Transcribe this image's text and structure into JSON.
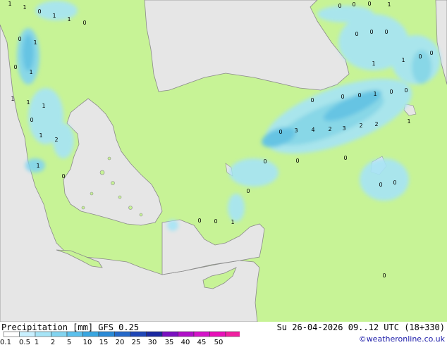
{
  "footer": {
    "title": "Precipitation [mm] GFS 0.25",
    "runinfo": "Su 26-04-2026 09..12 UTC (18+330)",
    "credit": "©weatheronline.co.uk"
  },
  "legend": {
    "ticks": [
      "0.1",
      "0.5",
      "1",
      "2",
      "5",
      "10",
      "15",
      "20",
      "25",
      "30",
      "35",
      "40",
      "45",
      "50"
    ],
    "colors": [
      "#ffffff",
      "#c8f0ff",
      "#a6e4f6",
      "#82d4f0",
      "#5bc0ec",
      "#39a6e0",
      "#2a8ad6",
      "#2468c8",
      "#1f46b6",
      "#1a28a0",
      "#7a10c0",
      "#b010c8",
      "#d414c8",
      "#e810b8",
      "#f020a0"
    ]
  },
  "map": {
    "colors": {
      "land": "#c7f396",
      "sea": "#e6e6e6",
      "coast": "#8a8a8a"
    },
    "labels": [
      {
        "text": "1"
      },
      {
        "text": "1"
      },
      {
        "text": "0"
      },
      {
        "text": "1"
      },
      {
        "text": "1"
      },
      {
        "text": "0"
      },
      {
        "text": "0"
      },
      {
        "text": "0"
      },
      {
        "text": "0"
      },
      {
        "text": "1"
      },
      {
        "text": "0"
      },
      {
        "text": "1"
      },
      {
        "text": "0"
      },
      {
        "text": "1"
      },
      {
        "text": "0"
      },
      {
        "text": "0"
      },
      {
        "text": "0"
      },
      {
        "text": "1"
      },
      {
        "text": "1"
      },
      {
        "text": "0"
      },
      {
        "text": "0"
      },
      {
        "text": "0"
      },
      {
        "text": "0"
      },
      {
        "text": "0"
      },
      {
        "text": "1"
      },
      {
        "text": "0"
      },
      {
        "text": "0"
      },
      {
        "text": "1"
      },
      {
        "text": "1"
      },
      {
        "text": "1"
      },
      {
        "text": "1"
      },
      {
        "text": "0"
      },
      {
        "text": "3"
      },
      {
        "text": "4"
      },
      {
        "text": "2"
      },
      {
        "text": "3"
      },
      {
        "text": "2"
      },
      {
        "text": "2"
      },
      {
        "text": "1"
      },
      {
        "text": "2"
      },
      {
        "text": "1"
      },
      {
        "text": "0"
      },
      {
        "text": "0"
      },
      {
        "text": "0"
      },
      {
        "text": "0"
      },
      {
        "text": "0"
      },
      {
        "text": "0"
      },
      {
        "text": "0"
      },
      {
        "text": "0"
      },
      {
        "text": "1"
      },
      {
        "text": "0"
      },
      {
        "text": "0"
      },
      {
        "text": "0"
      }
    ]
  }
}
